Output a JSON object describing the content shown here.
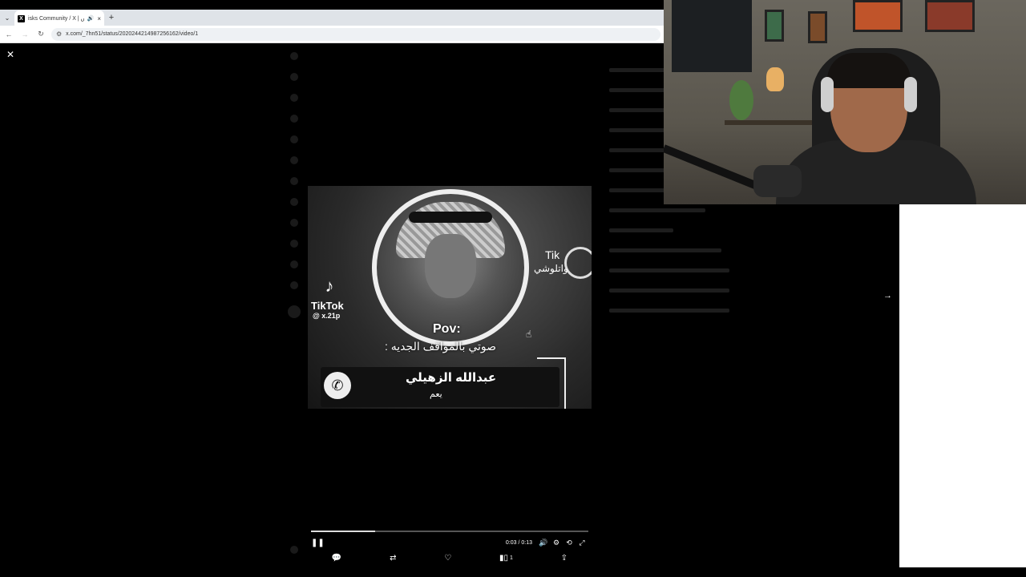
{
  "browser": {
    "tab": {
      "favicon": "X",
      "title": "isks Community / X | بيكس",
      "audio_icon": "speaker-icon",
      "close": "×"
    },
    "new_tab": "+",
    "tab_list": "⌄",
    "url": "x.com/_7hn51/status/2020244214987256162/video/1"
  },
  "viewer": {
    "close": "✕",
    "next": "→"
  },
  "video": {
    "tiktok": {
      "name": "TikTok",
      "handle": "@ x.21p"
    },
    "overlay_right": "Tik",
    "overlay_right_ar": "واتلوشي",
    "pov": "Pov:",
    "pov_ar": "صوتي بالمواقف الجديه :",
    "caller_name": "عبدالله الزهيلي",
    "caller_sub": "يعم",
    "progress": 0.23,
    "time": "0:03 / 0:13"
  },
  "actions": {
    "views_count": "1"
  },
  "colors": {
    "background": "#000000",
    "tabbar": "#dfe3e8",
    "text_light": "#ffffff"
  }
}
